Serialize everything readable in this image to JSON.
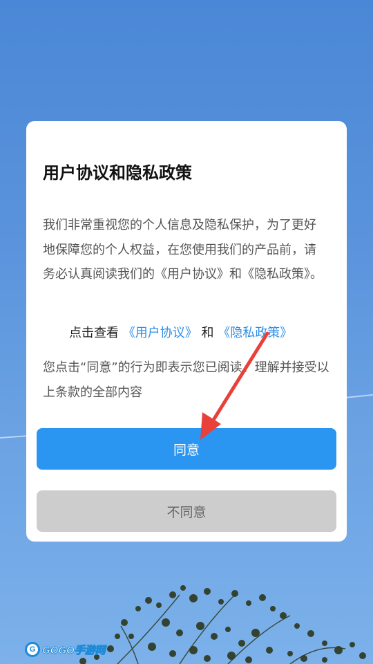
{
  "dialog": {
    "title": "用户协议和隐私政策",
    "body": "我们非常重视您的个人信息及隐私保护，为了更好地保障您的个人权益，在您使用我们的产品前，请务必认真阅读我们的《用户协议》和《隐私政策》。",
    "links_prefix": "点击查看",
    "link_user_agreement": "《用户协议》",
    "links_conjunction": "和",
    "link_privacy_policy": "《隐私政策》",
    "consent_text": "您点击“同意”的行为即表示您已阅读、理解并接受以上条款的全部内容",
    "agree_label": "同意",
    "disagree_label": "不同意"
  },
  "watermark": {
    "text": "GOGO手游网",
    "icon": "gogo-logo-icon"
  },
  "annotation": {
    "arrow_color": "#e8403a",
    "points_to": "agree-button"
  },
  "colors": {
    "accent": "#2b95f2",
    "link": "#2f8fe8",
    "disabled_button": "#cdcdcd",
    "sky": "#5a93dc"
  }
}
